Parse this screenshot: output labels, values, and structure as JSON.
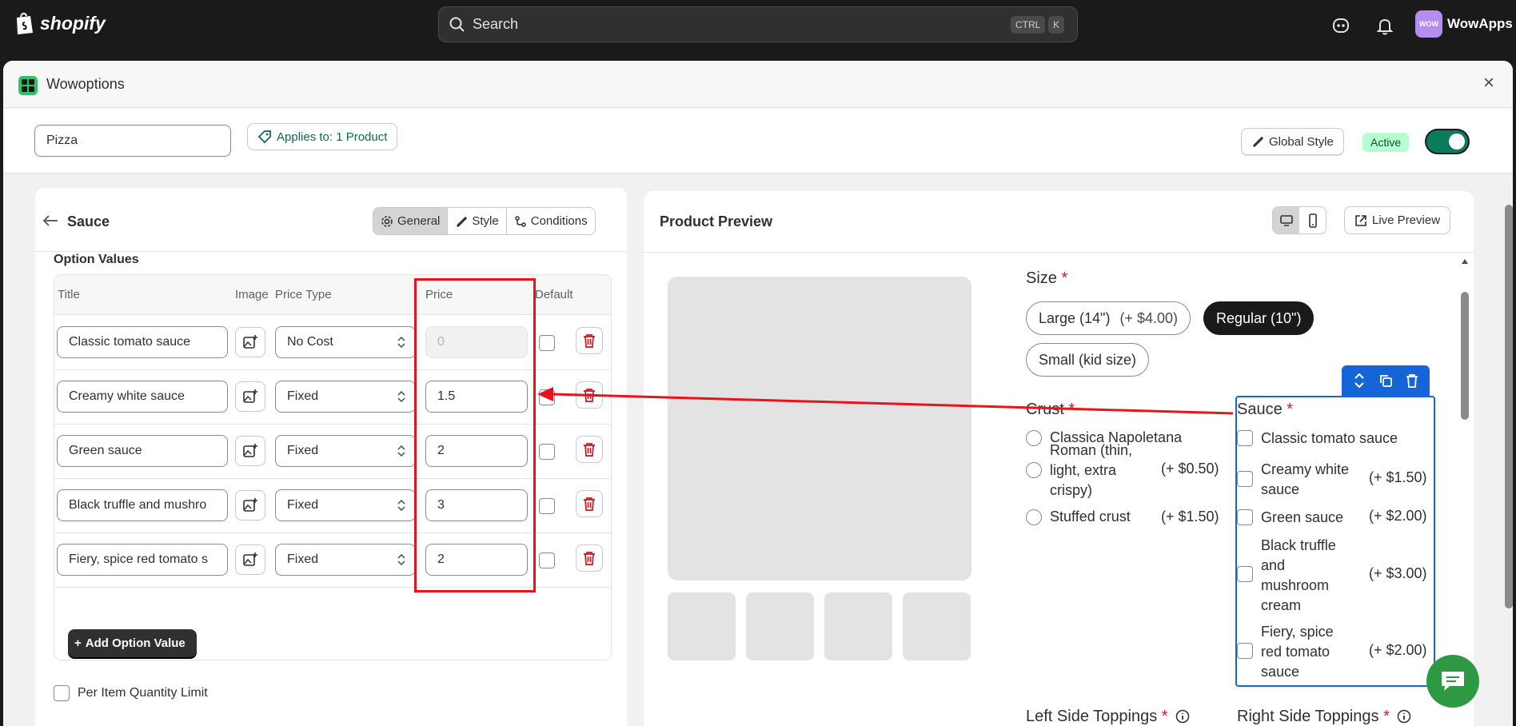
{
  "topbar": {
    "brand": "shopify",
    "search_placeholder": "Search",
    "kbd_ctrl": "CTRL",
    "kbd_k": "K",
    "user_initials": "WOW",
    "user_name": "WowApps"
  },
  "modal": {
    "title": "Wowoptions",
    "close": "×",
    "option_name": "Pizza",
    "applies_to": "Applies to: 1 Product",
    "global_style": "Global Style",
    "status": "Active",
    "active_toggle_on": true
  },
  "editor": {
    "title": "Sauce",
    "tabs": [
      {
        "label": "General",
        "selected": true
      },
      {
        "label": "Style",
        "selected": false
      },
      {
        "label": "Conditions",
        "selected": false
      }
    ],
    "section_label": "Option Values",
    "columns": [
      "Title",
      "Image",
      "Price Type",
      "Price",
      "Default"
    ],
    "rows": [
      {
        "title": "Classic tomato sauce",
        "price_type": "No Cost",
        "price": "0"
      },
      {
        "title": "Creamy white sauce",
        "price_type": "Fixed",
        "price": "1.5"
      },
      {
        "title": "Green sauce",
        "price_type": "Fixed",
        "price": "2"
      },
      {
        "title": "Black truffle and mushro",
        "price_type": "Fixed",
        "price": "3"
      },
      {
        "title": "Fiery, spice red tomato s",
        "price_type": "Fixed",
        "price": "2"
      }
    ],
    "add_button": "Add Option Value",
    "per_item_limit": "Per Item Quantity Limit"
  },
  "preview": {
    "title": "Product Preview",
    "live_preview": "Live Preview",
    "size": {
      "label": "Size",
      "required": "*",
      "options": [
        {
          "label": "Large (14\")",
          "price": "(+ $4.00)"
        },
        {
          "label": "Regular (10\")",
          "selected": true
        },
        {
          "label": "Small (kid size)"
        }
      ]
    },
    "crust": {
      "label": "Crust",
      "required": "*",
      "options": [
        {
          "line1": "Classica Napoletana",
          "price": ""
        },
        {
          "line1": "Roman (thin,",
          "line2": "light, extra",
          "line3": "crispy)",
          "price": "(+ $0.50)"
        },
        {
          "line1": "Stuffed crust",
          "price": "(+ $1.50)"
        }
      ]
    },
    "sauce": {
      "label": "Sauce",
      "required": "*",
      "options": [
        {
          "line1": "Classic tomato sauce",
          "price": ""
        },
        {
          "line1": "Creamy white",
          "line2": "sauce",
          "price": "(+ $1.50)"
        },
        {
          "line1": "Green sauce",
          "price": "(+ $2.00)"
        },
        {
          "line1": "Black truffle",
          "line2": "and",
          "line3": "mushroom",
          "line4": "cream",
          "price": "(+ $3.00)"
        },
        {
          "line1": "Fiery, spice",
          "line2": "red tomato",
          "line3": "sauce",
          "price": "(+ $2.00)"
        }
      ]
    },
    "left_toppings": {
      "label": "Left Side Toppings",
      "required": "*"
    },
    "right_toppings": {
      "label": "Right Side Toppings",
      "required": "*"
    }
  },
  "colors": {
    "annotation_red": "#e8131b",
    "selection_blue": "#1565d8",
    "active_green": "#0b7a5d",
    "chat_green": "#2d9a43"
  }
}
